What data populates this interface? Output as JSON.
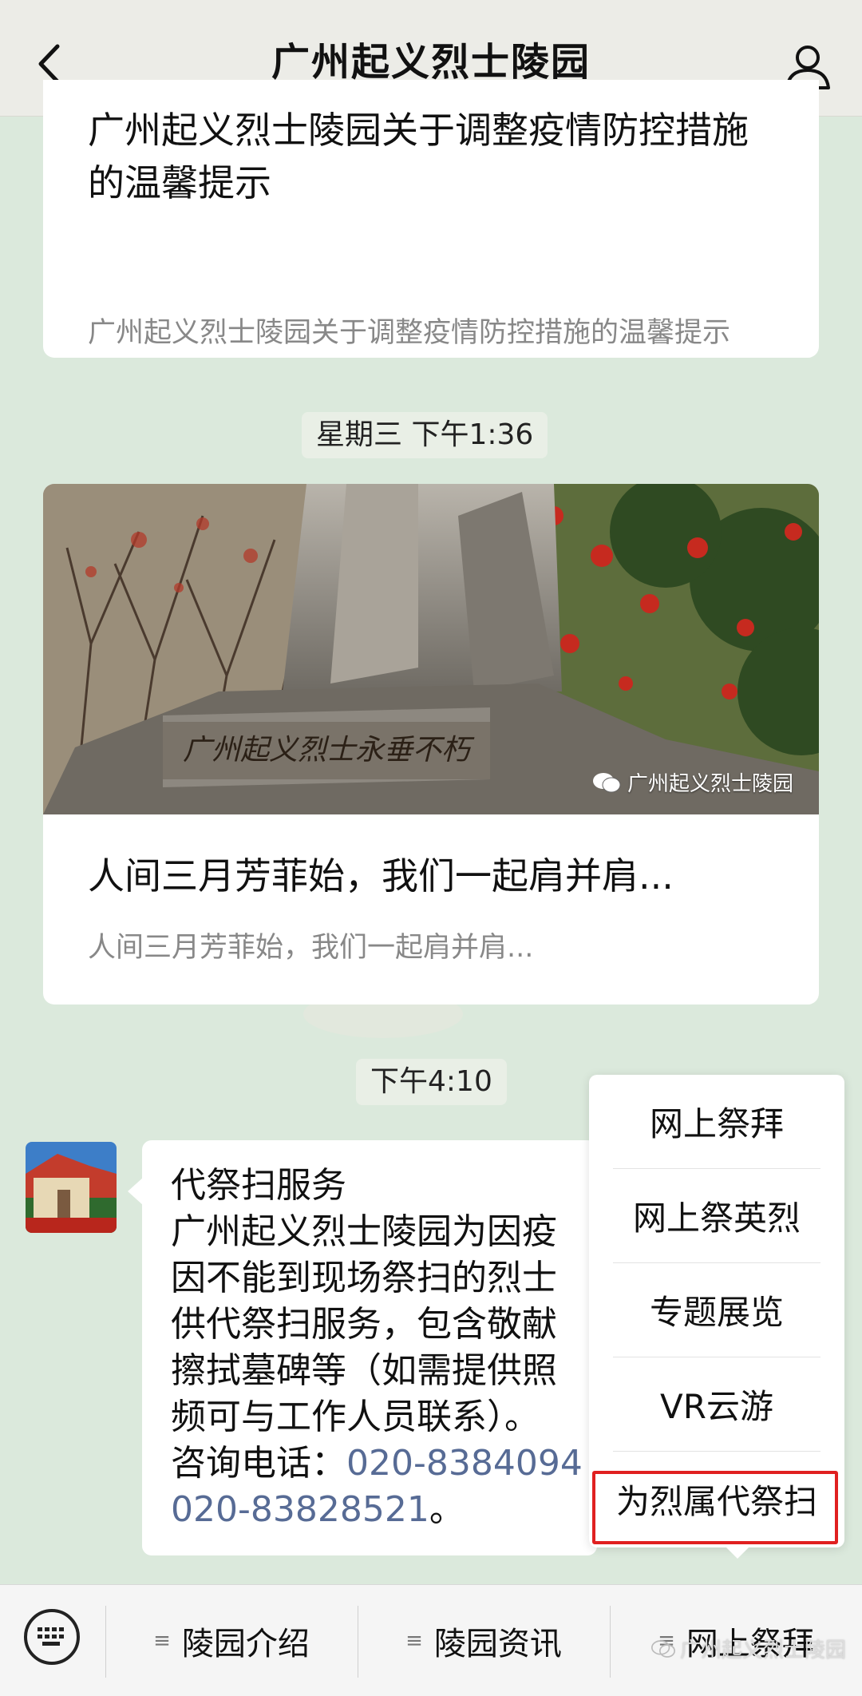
{
  "header": {
    "title": "广州起义烈士陵园"
  },
  "article1": {
    "title": "广州起义烈士陵园关于调整疫情防控措施的温馨提示",
    "desc": "广州起义烈士陵园关于调整疫情防控措施的温馨提示"
  },
  "time1": "星期三 下午1:36",
  "article2": {
    "title": "人间三月芳菲始，我们一起肩并肩...",
    "desc": "人间三月芳菲始，我们一起肩并肩...",
    "watermark": "广州起义烈士陵园",
    "stone_text": "广州起义烈士永垂不朽"
  },
  "time2": "下午4:10",
  "message": {
    "line1": "代祭扫服务",
    "line2": "广州起义烈士陵园为因疫",
    "line3": "因不能到现场祭扫的烈士",
    "line4": "供代祭扫服务，包含敬献",
    "line5": "擦拭墓碑等（如需提供照",
    "line6": "频可与工作人员联系）。",
    "line7_prefix": "咨询电话：",
    "phone1": "020-8384094",
    "phone2": "020-83828521",
    "line8_suffix": "。"
  },
  "popup": {
    "items": [
      "网上祭拜",
      "网上祭英烈",
      "专题展览",
      "VR云游",
      "为烈属代祭扫"
    ]
  },
  "bottom": {
    "tabs": [
      "陵园介绍",
      "陵园资讯",
      "网上祭拜"
    ],
    "watermark": "广州起义烈士陵园"
  },
  "colors": {
    "link": "#576b95",
    "highlight": "#e02020",
    "background": "#dbe9dc"
  }
}
